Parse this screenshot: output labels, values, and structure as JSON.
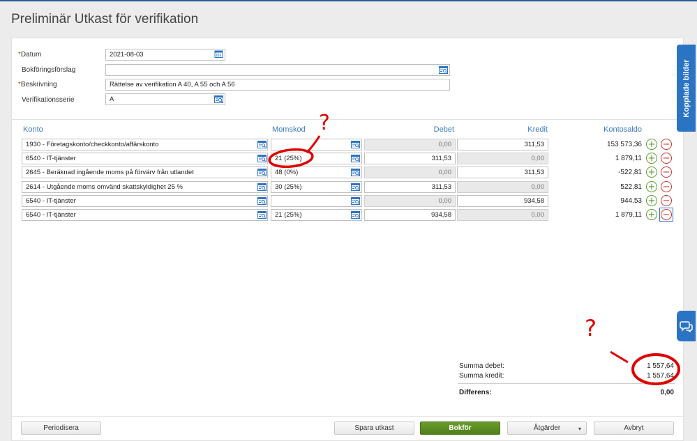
{
  "page": {
    "title": "Preliminär Utkast för verifikation"
  },
  "form": {
    "datum": {
      "label": "Datum",
      "value": "2021-08-03"
    },
    "bokforingsforslag": {
      "label": "Bokföringsförslag",
      "value": ""
    },
    "beskrivning": {
      "label": "Beskrivning",
      "value": "Rättelse av verifikation A 40, A 55 och A 56"
    },
    "verifikationsserie": {
      "label": "Verifikationsserie",
      "value": "A"
    },
    "required_mark": "*"
  },
  "table": {
    "headers": {
      "konto": "Konto",
      "momskod": "Momskod",
      "debet": "Debet",
      "kredit": "Kredit",
      "kontosaldo": "Kontosaldo"
    },
    "rows": [
      {
        "konto": "1930 - Företagskonto/checkkonto/affärskonto",
        "momskod": "",
        "debet": "0,00",
        "kredit": "311,53",
        "saldo": "153 573,36"
      },
      {
        "konto": "6540 - IT-tjänster",
        "momskod": "21 (25%)",
        "debet": "311,53",
        "kredit": "0,00",
        "saldo": "1 879,11"
      },
      {
        "konto": "2645 - Beräknad ingående moms på förvärv från utlandet",
        "momskod": "48 (0%)",
        "debet": "0,00",
        "kredit": "311,53",
        "saldo": "-522,81"
      },
      {
        "konto": "2614 - Utgående moms omvänd skattskyldighet 25 %",
        "momskod": "30 (25%)",
        "debet": "311,53",
        "kredit": "0,00",
        "saldo": "522,81"
      },
      {
        "konto": "6540 - IT-tjänster",
        "momskod": "",
        "debet": "0,00",
        "kredit": "934,58",
        "saldo": "944,53"
      },
      {
        "konto": "6540 - IT-tjänster",
        "momskod": "21 (25%)",
        "debet": "934,58",
        "kredit": "0,00",
        "saldo": "1 879,11"
      }
    ],
    "add_symbol": "+",
    "remove_symbol": "−"
  },
  "summary": {
    "debet_label": "Summa debet:",
    "debet_value": "1 557,64",
    "kredit_label": "Summa kredit:",
    "kredit_value": "1 557,64",
    "diff_label": "Differens:",
    "diff_value": "0,00"
  },
  "footer": {
    "periodisera": "Periodisera",
    "spara": "Spara utkast",
    "bokfor": "Bokför",
    "atgarder": "Åtgärder",
    "avbryt": "Avbryt",
    "caret": "▾"
  },
  "side": {
    "kopplade_bilder": "Kopplade bilder"
  },
  "icons": {
    "lookup": "search-list-icon",
    "calendar": "calendar-icon",
    "chat": "chat-icon",
    "add": "plus-circle-icon",
    "remove": "minus-circle-icon"
  },
  "annotations": {
    "question_mark": "?"
  },
  "colors": {
    "accent": "#2b74c4",
    "primary_button": "#5a8c24",
    "annotation": "#e00000",
    "add": "#5b9a2a",
    "remove": "#c0392b"
  }
}
